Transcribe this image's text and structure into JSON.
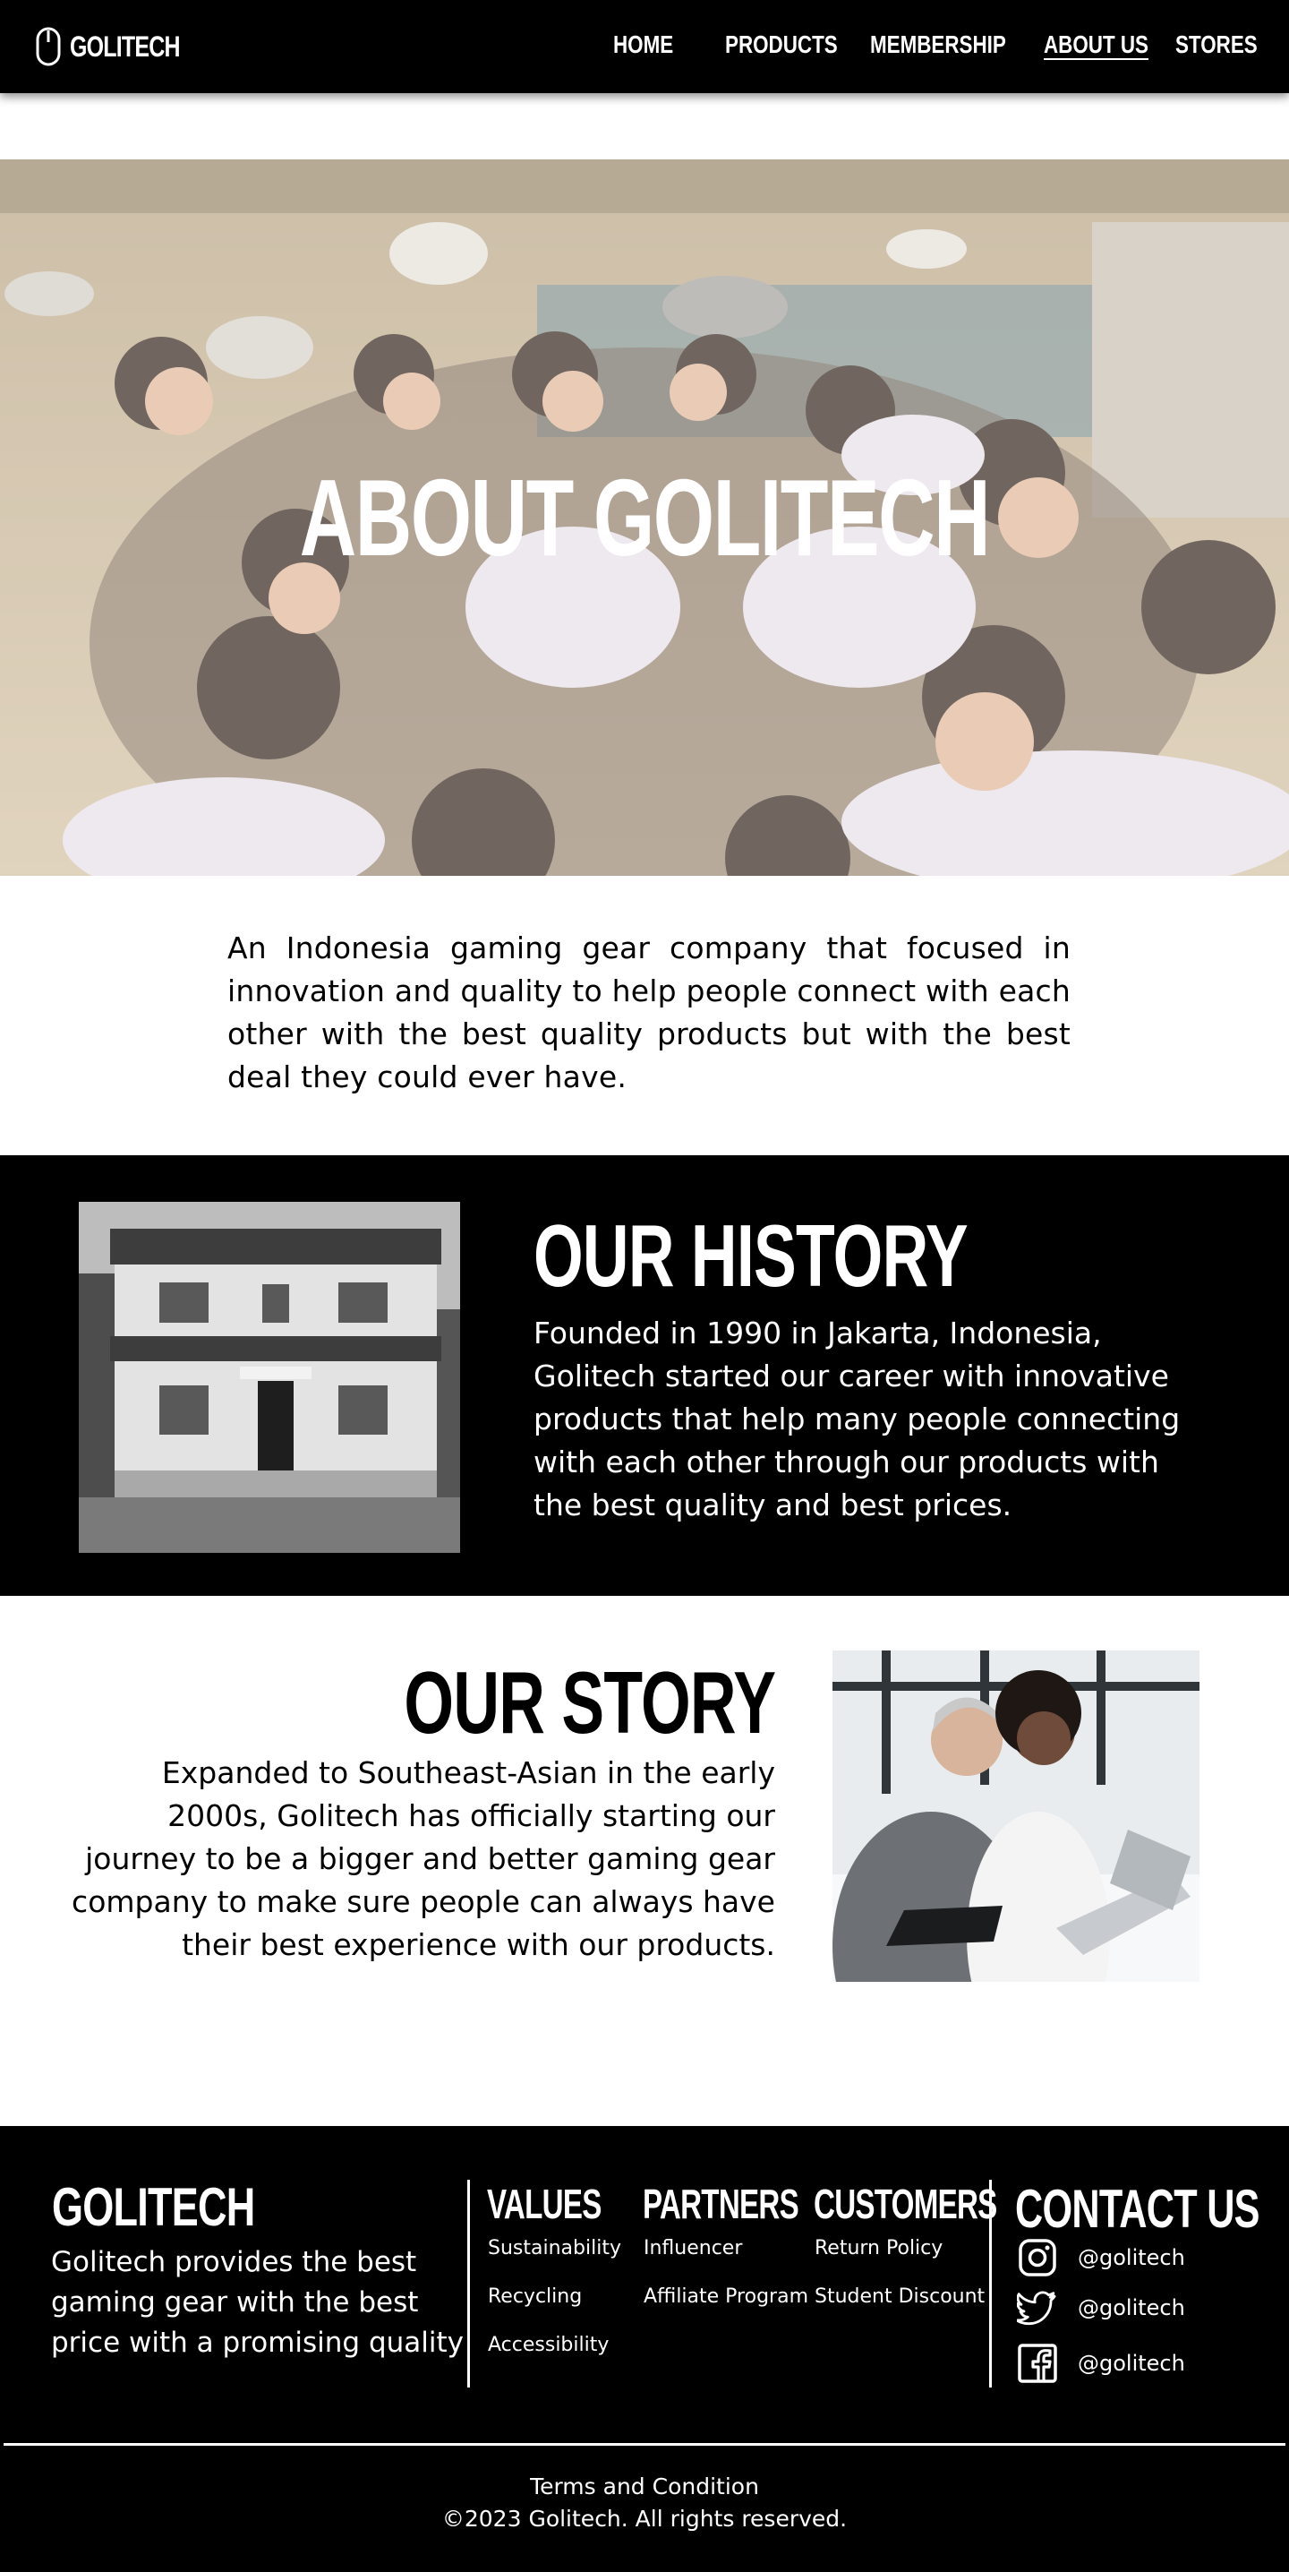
{
  "brand": {
    "name": "GOLITECH",
    "logo_icon": "mouse-icon"
  },
  "nav": {
    "items": [
      {
        "label": "HOME",
        "active": false
      },
      {
        "label": "PRODUCTS",
        "active": false
      },
      {
        "label": "MEMBERSHIP",
        "active": false
      },
      {
        "label": "ABOUT US",
        "active": true
      },
      {
        "label": "STORES",
        "active": false
      }
    ]
  },
  "hero": {
    "title": "ABOUT GOLITECH",
    "image": "group-of-people-hands-together-photo"
  },
  "intro": {
    "text": "An Indonesia gaming gear company that focused in innovation and quality to help people connect with each other with the best quality products but with the best deal they could ever have."
  },
  "history": {
    "title": "OUR HISTORY",
    "text": "Founded in 1990 in Jakarta, Indonesia, Golitech started our career with innovative products that help many people connecting with each other through our products with the best quality and best prices.",
    "image": "old-building-photo"
  },
  "story": {
    "title": "OUR STORY",
    "text": "Expanded to Southeast-Asian in the early 2000s, Golitech has officially starting our journey to be a bigger and better gaming gear company to make sure people can always have their best experience with our products.",
    "image": "two-people-at-laptop-photo"
  },
  "footer": {
    "brand_title": "GOLITECH",
    "brand_text": "Golitech provides the best gaming gear with the best price with a promising quality",
    "columns": [
      {
        "title": "VALUES",
        "links": [
          "Sustainability",
          "Recycling",
          "Accessibility"
        ]
      },
      {
        "title": "PARTNERS",
        "links": [
          "Influencer",
          "Affiliate Program"
        ]
      },
      {
        "title": "CUSTOMERS",
        "links": [
          "Return Policy",
          "Student Discount"
        ]
      }
    ],
    "contact": {
      "title": "CONTACT US",
      "items": [
        {
          "icon": "instagram-icon",
          "handle": "@golitech"
        },
        {
          "icon": "twitter-icon",
          "handle": "@golitech"
        },
        {
          "icon": "facebook-icon",
          "handle": "@golitech"
        }
      ]
    },
    "terms": "Terms and Condition",
    "copyright": "©2023 Golitech. All rights reserved."
  },
  "colors": {
    "background": "#ffffff",
    "dark": "#000000",
    "text_light": "#ffffff"
  }
}
